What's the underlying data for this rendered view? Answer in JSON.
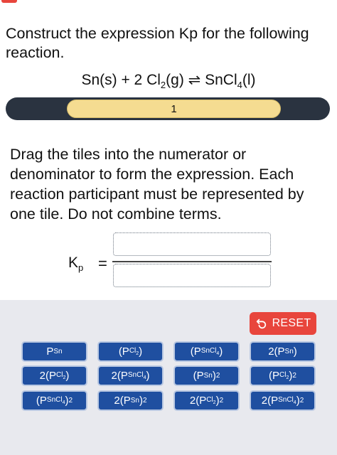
{
  "question": "Construct the expression Kp for the following reaction.",
  "equation": {
    "lhs1": "Sn(s) + 2 Cl",
    "lhs1_sub": "2",
    "lhs2": "(g)",
    "arrow": "⇌",
    "rhs1": "SnCl",
    "rhs1_sub": "4",
    "rhs2": "(l)"
  },
  "progress": {
    "label": "1"
  },
  "instructions": "Drag the tiles into the numerator or denominator to form the expression. Each reaction participant must be represented by one tile. Do not combine terms.",
  "kp": {
    "main": "K",
    "sub": "p",
    "equals": "="
  },
  "reset_label": "RESET",
  "tiles": [
    {
      "pre": "P",
      "sub": "Sn",
      "post": ""
    },
    {
      "pre": "(P",
      "sub": "Cl",
      "subsub": "2",
      "post": ")"
    },
    {
      "pre": "(P",
      "sub": "SnCl",
      "subsub": "4",
      "post": ")"
    },
    {
      "pre": "2(P",
      "sub": "Sn",
      "post": ")"
    },
    {
      "pre": "2(P",
      "sub": "Cl",
      "subsub": "2",
      "post": ")"
    },
    {
      "pre": "2(P",
      "sub": "SnCl",
      "subsub": "4",
      "post": ")"
    },
    {
      "pre": "(P",
      "sub": "Sn",
      "post": ")",
      "sup": "2"
    },
    {
      "pre": "(P",
      "sub": "Cl",
      "subsub": "2",
      "post": ")",
      "sup": "2"
    },
    {
      "pre": "(P",
      "sub": "SnCl",
      "subsub": "4",
      "post": ")",
      "sup": "2"
    },
    {
      "pre": "2(P",
      "sub": "Sn",
      "post": ")",
      "sup": "2"
    },
    {
      "pre": "2(P",
      "sub": "Cl",
      "subsub": "2",
      "post": ")",
      "sup": "2"
    },
    {
      "pre": "2(P",
      "sub": "SnCl",
      "subsub": "4",
      "post": ")",
      "sup": "2"
    }
  ],
  "colors": {
    "accent": "#e8453c",
    "tile": "#1f4fa0",
    "progress_track": "#2a3340",
    "progress_pill": "#f5dc91"
  }
}
